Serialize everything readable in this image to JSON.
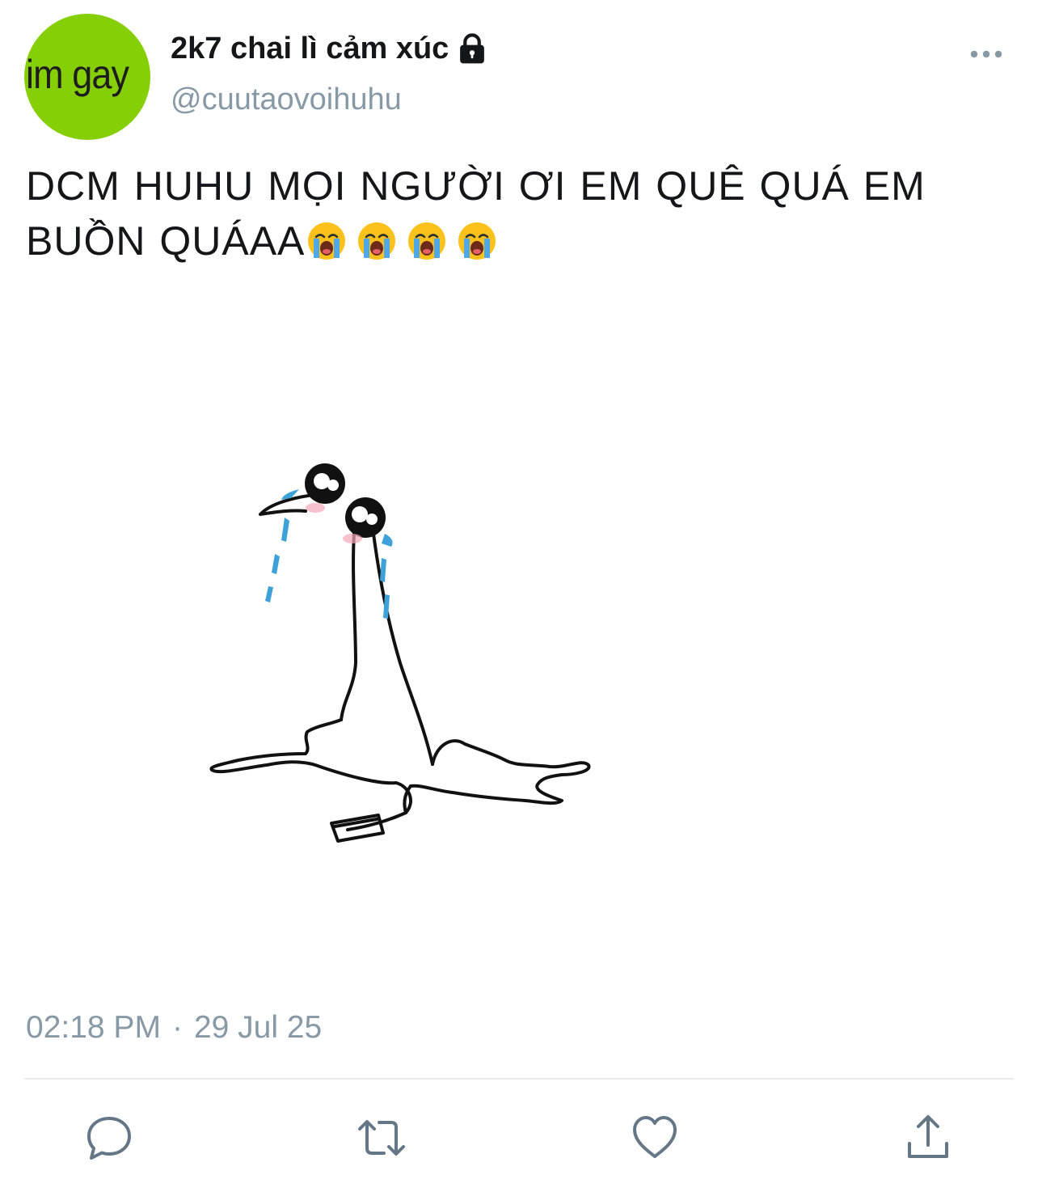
{
  "profile": {
    "avatar_text": "im gay",
    "avatar_color": "#86cf06",
    "display_name": "2k7 chai lì cảm xúc",
    "handle": "@cuutaovoihuhu",
    "protected_icon": "lock-icon"
  },
  "tweet": {
    "text": "DCM HUHU MỌI NGƯỜI ƠI EM QUÊ QUÁ EM BUỒN QUÁAA",
    "emojis": [
      "loudly-crying-face-emoji",
      "loudly-crying-face-emoji",
      "loudly-crying-face-emoji",
      "loudly-crying-face-emoji"
    ],
    "media_description_icon": "crying-stick-figure-drawing"
  },
  "meta": {
    "time": "02:18 PM",
    "separator": "·",
    "date": "29 Jul 25"
  },
  "actions": {
    "reply_icon": "reply-icon",
    "retweet_icon": "retweet-icon",
    "like_icon": "heart-icon",
    "share_icon": "share-icon",
    "more_icon": "more-options-icon"
  },
  "colors": {
    "text_primary": "#14171a",
    "text_secondary": "#8899a6",
    "divider": "#e6ecf0"
  }
}
